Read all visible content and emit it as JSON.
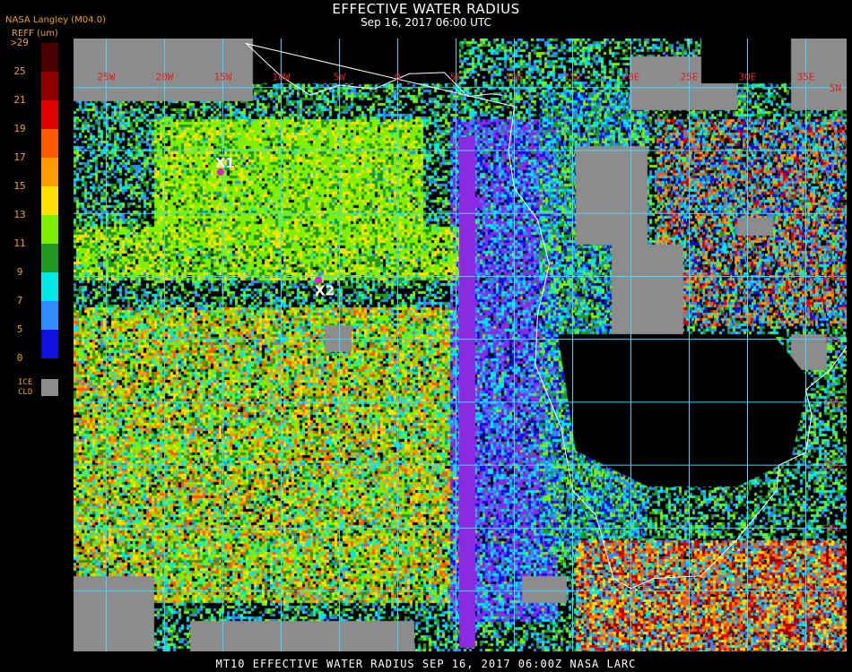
{
  "header": {
    "title": "EFFECTIVE WATER RADIUS",
    "subtitle": "Sep 16, 2017 06:00 UTC",
    "brand": "NASA Langley (M04.0)",
    "units": "REFF (um)"
  },
  "legend": {
    "ticks": [
      ">29",
      "25",
      "21",
      "19",
      "17",
      "15",
      "13",
      "11",
      "9",
      "7",
      "5",
      "0"
    ],
    "colors": [
      "#4a0000",
      "#8e0000",
      "#e00000",
      "#ff5a00",
      "#ff9a00",
      "#ffe000",
      "#80f000",
      "#1f9a1f",
      "#00e8e8",
      "#2f8cff",
      "#1010e0",
      "#8a2be2"
    ],
    "ice_label_1": "ICE",
    "ice_label_2": "CLD",
    "ice_color": "#8c8c8c"
  },
  "map": {
    "lon_labels": [
      "25W",
      "20W",
      "15W",
      "10W",
      "5W",
      "0",
      "5E",
      "10E",
      "15E",
      "20E",
      "25E",
      "30E",
      "35E"
    ],
    "lat_labels": [
      "5N",
      "0",
      "5S",
      "10S",
      "15S",
      "20S",
      "25S",
      "30S",
      "35S"
    ],
    "grid_color": "#40d8ff",
    "coast_color": "#ffffff",
    "markers": [
      {
        "label": "X1",
        "color": "#e020c0",
        "lon": -15.2,
        "lat": -1.7
      },
      {
        "label": "X2",
        "color": "#e020c0",
        "lon": -6.8,
        "lat": -10.3
      }
    ]
  },
  "footer": {
    "text": "MT10  EFFECTIVE WATER RADIUS  SEP 16, 2017 06:00Z  NASA LARC"
  }
}
